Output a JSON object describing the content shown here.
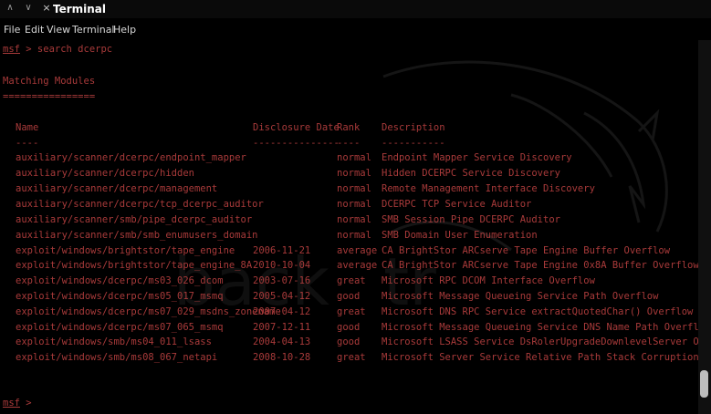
{
  "window": {
    "title": "Terminal",
    "controls": {
      "minimize": "∧",
      "maximize": "∨",
      "close": "×"
    }
  },
  "menu": [
    "File",
    "Edit",
    "View",
    "Terminal",
    "Help"
  ],
  "terminal": {
    "prompt": "msf",
    "command_line": " > search dcerpc",
    "section_title": "Matching Modules",
    "section_underline": "================",
    "headers": {
      "name": "Name",
      "date": "Disclosure Date",
      "rank": "Rank",
      "description": "Description"
    },
    "header_underlines": {
      "name": "----",
      "date": "---------------",
      "rank": "----",
      "description": "-----------"
    },
    "modules": [
      {
        "name": "auxiliary/scanner/dcerpc/endpoint_mapper",
        "date": "",
        "rank": "normal",
        "description": "Endpoint Mapper Service Discovery"
      },
      {
        "name": "auxiliary/scanner/dcerpc/hidden",
        "date": "",
        "rank": "normal",
        "description": "Hidden DCERPC Service Discovery"
      },
      {
        "name": "auxiliary/scanner/dcerpc/management",
        "date": "",
        "rank": "normal",
        "description": "Remote Management Interface Discovery"
      },
      {
        "name": "auxiliary/scanner/dcerpc/tcp_dcerpc_auditor",
        "date": "",
        "rank": "normal",
        "description": "DCERPC TCP Service Auditor"
      },
      {
        "name": "auxiliary/scanner/smb/pipe_dcerpc_auditor",
        "date": "",
        "rank": "normal",
        "description": "SMB Session Pipe DCERPC Auditor"
      },
      {
        "name": "auxiliary/scanner/smb/smb_enumusers_domain",
        "date": "",
        "rank": "normal",
        "description": "SMB Domain User Enumeration"
      },
      {
        "name": "exploit/windows/brightstor/tape_engine",
        "date": "2006-11-21",
        "rank": "average",
        "description": "CA BrightStor ARCserve Tape Engine Buffer Overflow"
      },
      {
        "name": "exploit/windows/brightstor/tape_engine_8A",
        "date": "2010-10-04",
        "rank": "average",
        "description": "CA BrightStor ARCserve Tape Engine 0x8A Buffer Overflow"
      },
      {
        "name": "exploit/windows/dcerpc/ms03_026_dcom",
        "date": "2003-07-16",
        "rank": "great",
        "description": "Microsoft RPC DCOM Interface Overflow"
      },
      {
        "name": "exploit/windows/dcerpc/ms05_017_msmq",
        "date": "2005-04-12",
        "rank": "good",
        "description": "Microsoft Message Queueing Service Path Overflow"
      },
      {
        "name": "exploit/windows/dcerpc/ms07_029_msdns_zonename",
        "date": "2007-04-12",
        "rank": "great",
        "description": "Microsoft DNS RPC Service extractQuotedChar() Overflow (TCP)"
      },
      {
        "name": "exploit/windows/dcerpc/ms07_065_msmq",
        "date": "2007-12-11",
        "rank": "good",
        "description": "Microsoft Message Queueing Service DNS Name Path Overflow"
      },
      {
        "name": "exploit/windows/smb/ms04_011_lsass",
        "date": "2004-04-13",
        "rank": "good",
        "description": "Microsoft LSASS Service DsRolerUpgradeDownlevelServer Overflow"
      },
      {
        "name": "exploit/windows/smb/ms08_067_netapi",
        "date": "2008-10-28",
        "rank": "great",
        "description": "Microsoft Server Service Relative Path Stack Corruption"
      }
    ],
    "final_prompt": "msf",
    "final_prompt_suffix": " > "
  },
  "colors": {
    "text": "#a83a3a",
    "background": "#000000",
    "title_text": "#ffffff",
    "menu_text": "#d8d8d8"
  },
  "icons": {
    "background_art": "dragon-logo-icon"
  }
}
